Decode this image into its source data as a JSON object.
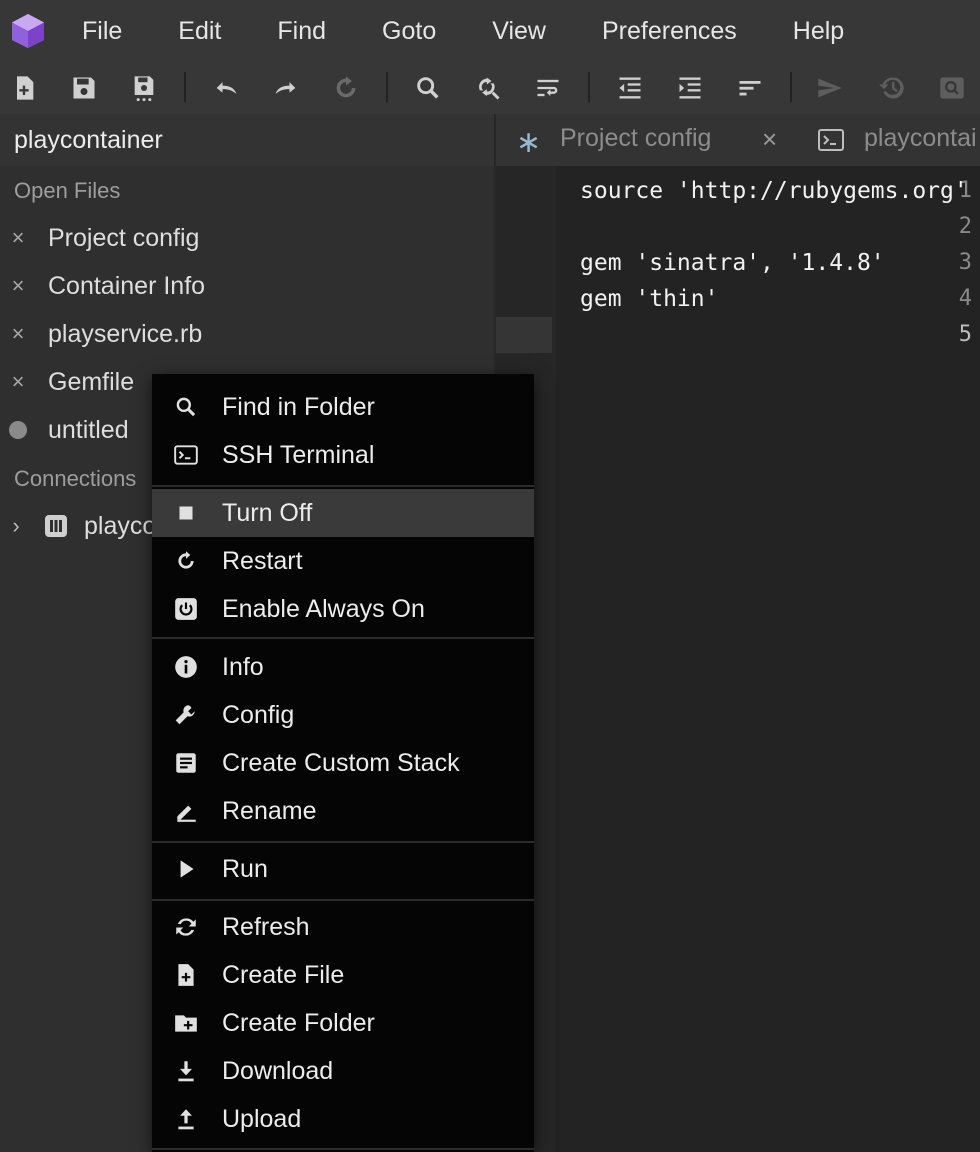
{
  "menubar": {
    "items": [
      "File",
      "Edit",
      "Find",
      "Goto",
      "View",
      "Preferences",
      "Help"
    ]
  },
  "toolbar": {
    "icons": [
      "new-file-icon",
      "save-icon",
      "save-all-icon",
      "undo-icon",
      "redo-icon",
      "reload-icon",
      "search-icon",
      "replace-icon",
      "wrap-icon",
      "outdent-icon",
      "indent-icon",
      "sort-icon",
      "send-icon",
      "history-icon",
      "preview-icon"
    ]
  },
  "project": {
    "name": "playcontainer"
  },
  "tabs": [
    {
      "label": "Project config",
      "icon": "asterisk-icon"
    },
    {
      "label": "playcontai",
      "icon": "terminal-icon"
    }
  ],
  "sidebar": {
    "open_files_title": "Open Files",
    "open_files": [
      {
        "label": "Project config",
        "state": "closable"
      },
      {
        "label": "Container Info",
        "state": "closable"
      },
      {
        "label": "playservice.rb",
        "state": "closable"
      },
      {
        "label": "Gemfile",
        "state": "closable"
      },
      {
        "label": "untitled",
        "state": "modified"
      }
    ],
    "connections_title": "Connections",
    "connection": {
      "label": "playco"
    }
  },
  "editor": {
    "line_numbers": [
      "1",
      "2",
      "3",
      "4",
      "5"
    ],
    "lines": [
      "source 'http://rubygems.org'",
      "",
      "gem 'sinatra', '1.4.8'",
      "gem 'thin'",
      ""
    ],
    "active_line": 5
  },
  "context_menu": {
    "groups": [
      [
        {
          "label": "Find in Folder",
          "icon": "search-icon"
        },
        {
          "label": "SSH Terminal",
          "icon": "terminal-icon"
        }
      ],
      [
        {
          "label": "Turn Off",
          "icon": "stop-icon",
          "highlighted": true
        },
        {
          "label": "Restart",
          "icon": "restart-icon"
        },
        {
          "label": "Enable Always On",
          "icon": "power-icon"
        }
      ],
      [
        {
          "label": "Info",
          "icon": "info-icon"
        },
        {
          "label": "Config",
          "icon": "wrench-icon"
        },
        {
          "label": "Create Custom Stack",
          "icon": "list-icon"
        },
        {
          "label": "Rename",
          "icon": "pencil-icon"
        }
      ],
      [
        {
          "label": "Run",
          "icon": "play-icon"
        }
      ],
      [
        {
          "label": "Refresh",
          "icon": "refresh-icon"
        },
        {
          "label": "Create File",
          "icon": "file-add-icon"
        },
        {
          "label": "Create Folder",
          "icon": "folder-add-icon"
        },
        {
          "label": "Download",
          "icon": "download-icon"
        },
        {
          "label": "Upload",
          "icon": "upload-icon"
        }
      ]
    ]
  },
  "colors": {
    "logo_purple": "#8e5bd6",
    "menu_bg": "#000000",
    "highlight": "#3a3a3a"
  }
}
